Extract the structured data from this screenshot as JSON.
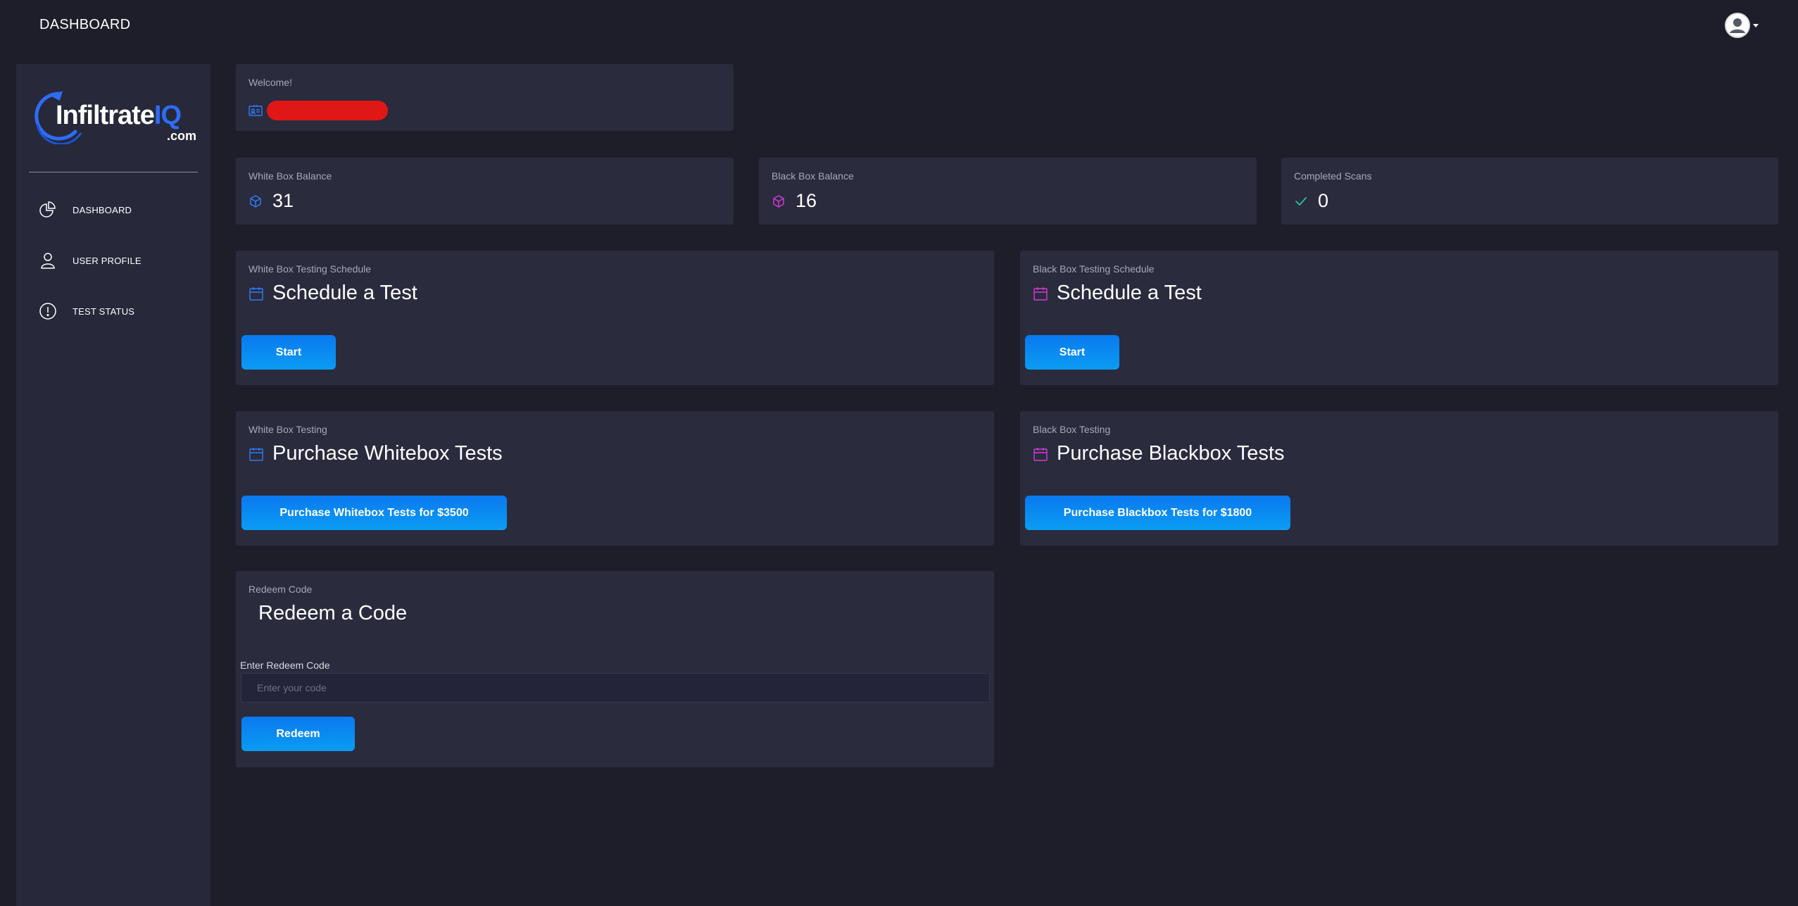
{
  "topbar": {
    "title": "DASHBOARD"
  },
  "sidebar": {
    "logo": {
      "main_white": "Infiltrate",
      "main_blue": "IQ",
      "sub": ".com"
    },
    "items": [
      {
        "label": "DASHBOARD",
        "icon": "pie-chart-icon"
      },
      {
        "label": "USER PROFILE",
        "icon": "user-icon"
      },
      {
        "label": "TEST STATUS",
        "icon": "info-circle-icon"
      }
    ]
  },
  "welcome": {
    "label": "Welcome!",
    "icon": "id-card-icon"
  },
  "stats": [
    {
      "label": "White Box Balance",
      "value": "31",
      "icon": "cube-icon",
      "color": "#2f7cf6"
    },
    {
      "label": "Black Box Balance",
      "value": "16",
      "icon": "cube-icon",
      "color": "#d43ad6"
    },
    {
      "label": "Completed Scans",
      "value": "0",
      "icon": "check-icon",
      "color": "#1fc99b"
    }
  ],
  "schedule": [
    {
      "label": "White Box Testing Schedule",
      "heading": "Schedule a Test",
      "button": "Start",
      "icon": "calendar-icon",
      "color": "#2f7cf6"
    },
    {
      "label": "Black Box Testing Schedule",
      "heading": "Schedule a Test",
      "button": "Start",
      "icon": "calendar-icon",
      "color": "#d43ad6"
    }
  ],
  "purchase": [
    {
      "label": "White Box Testing",
      "heading": "Purchase Whitebox Tests",
      "button": "Purchase Whitebox Tests for $3500",
      "icon": "calendar-icon",
      "color": "#2f7cf6"
    },
    {
      "label": "Black Box Testing",
      "heading": "Purchase Blackbox Tests",
      "button": "Purchase Blackbox Tests for $1800",
      "icon": "calendar-icon",
      "color": "#d43ad6"
    }
  ],
  "redeem": {
    "label": "Redeem Code",
    "heading": "Redeem a Code",
    "field_label": "Enter Redeem Code",
    "placeholder": "Enter your code",
    "value": "",
    "button": "Redeem"
  },
  "colors": {
    "background": "#1e1e2b",
    "card": "#2a2b3d",
    "accent_blue": "#0a84f0",
    "redaction": "#e01717"
  }
}
